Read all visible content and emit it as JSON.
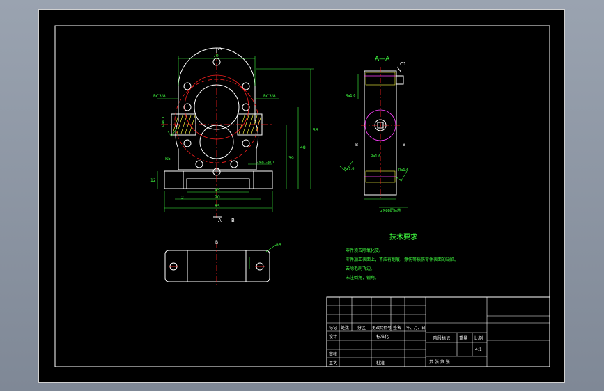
{
  "colors": {
    "background": "#000000",
    "outline": "#ffffff",
    "centerline": "#ff2020",
    "hidden": "#ff40ff",
    "dimension": "#40ff40",
    "hatch": "#ffff40"
  },
  "section_label_a_top": "A",
  "section_label_a_bottom": "A",
  "section_label_b_bottom": "B",
  "section_view_title": "A—A",
  "chamfer_label": "C1",
  "dims": {
    "top_width": "70",
    "thread_left": "RC3/8",
    "thread_right": "RC3/8",
    "height_right_1": "48",
    "height_right_2": "56",
    "height_right_3": "39",
    "bottom_45": "45",
    "bottom_70": "70",
    "bottom_85": "85",
    "left_12": "12",
    "left_2": "2",
    "r_left": "R5",
    "holes_note": "2×φ7-φ10",
    "hole_depth": "2×φ8配钻通",
    "side_b1": "B",
    "side_b2": "B",
    "ra_a": "Ra1.6",
    "ra_b": "Ra1.6",
    "ra_c": "Ra1.6",
    "ra_d": "Ra1.6",
    "ra_e": "Ra6.3",
    "bottom_view_b": "B",
    "bottom_view_r": "R5"
  },
  "tech_req": {
    "title": "技术要求",
    "lines": [
      "零件须去除氧化皮。",
      "零件加工表面上，不应有划痕、擦伤等损伤零件表面的缺陷。",
      "去除毛刺飞边。",
      "未注倒角，锐角。"
    ]
  },
  "title_block": {
    "headers": [
      "标记",
      "处数",
      "分区",
      "更改文件号",
      "签名",
      "年、月、日"
    ],
    "design": "设计",
    "standard": "标准化",
    "stage_mark": "阶段标记",
    "weight": "重量",
    "scale": "比例",
    "scale_value": "4:1",
    "review": "审核",
    "process": "工艺",
    "approve": "批准",
    "sheet_text": "共 张 第 张"
  }
}
